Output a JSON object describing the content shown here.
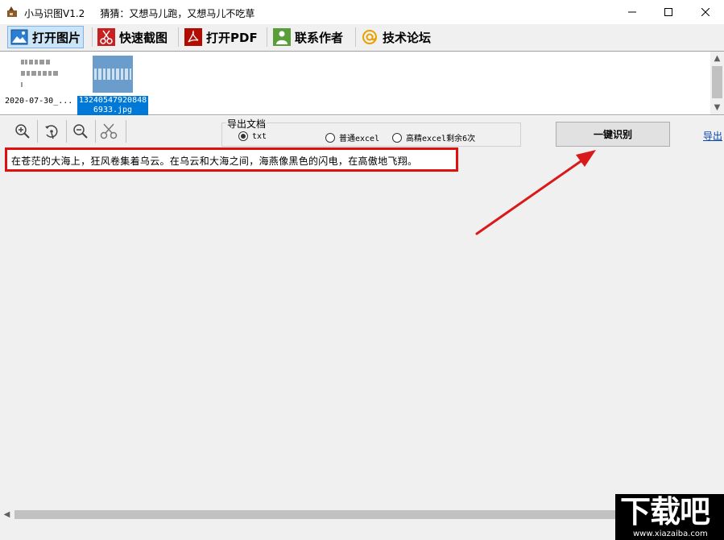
{
  "window": {
    "title": "小马识图V1.2",
    "subtitle": "猜猜：又想马儿跑，又想马儿不吃草",
    "controls": [
      "minimize",
      "maximize",
      "close"
    ]
  },
  "toolbar": {
    "items": [
      {
        "label": "打开图片",
        "icon": "picture-icon",
        "active": true
      },
      {
        "label": "快速截图",
        "icon": "scissors-icon",
        "active": false
      },
      {
        "label": "打开PDF",
        "icon": "pdf-icon",
        "active": false
      },
      {
        "label": "联系作者",
        "icon": "contact-icon",
        "active": false
      },
      {
        "label": "技术论坛",
        "icon": "at-icon",
        "active": false
      }
    ]
  },
  "thumbnails": [
    {
      "label": "2020-07-30_...",
      "selected": false
    },
    {
      "label_line1": "13240547920848",
      "label_line2": "6933.jpg",
      "selected": true
    }
  ],
  "image_tools": [
    "zoom-in-icon",
    "rotate-icon",
    "zoom-out-icon",
    "scissors-icon"
  ],
  "export": {
    "legend": "导出文档",
    "options": [
      {
        "label": "txt",
        "checked": true
      },
      {
        "label": "普通excel",
        "checked": false
      },
      {
        "label": "高精excel剩余6次",
        "checked": false
      }
    ]
  },
  "recognize_button": "一键识别",
  "export_link": "导出",
  "result_text": "在苍茫的大海上，狂风卷集着乌云。在乌云和大海之间，海燕像黑色的闪电，在高傲地飞翔。",
  "watermark": {
    "big": "下载吧",
    "small": "www.xiazaiba.com"
  },
  "colors": {
    "highlight_red": "#e01010",
    "selection_blue": "#0078d7",
    "arrow_red": "#d91a1a"
  }
}
